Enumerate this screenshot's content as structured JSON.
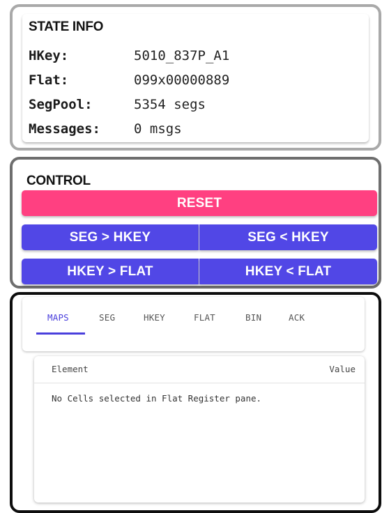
{
  "state_info": {
    "title": "STATE INFO",
    "rows": [
      {
        "key": "HKey:",
        "value": "5010_837P_A1"
      },
      {
        "key": "Flat:",
        "value": "099x00000889"
      },
      {
        "key": "SegPool:",
        "value": "5354 segs"
      },
      {
        "key": "Messages:",
        "value": "0 msgs"
      }
    ]
  },
  "control": {
    "title": "CONTROL",
    "reset_label": "RESET",
    "seg_to_hkey_label": "SEG > HKEY",
    "hkey_to_seg_label": "SEG < HKEY",
    "hkey_to_flat_label": "HKEY > FLAT",
    "flat_to_hkey_label": "HKEY < FLAT"
  },
  "tabs": {
    "items": [
      {
        "label": "MAPS",
        "active": true
      },
      {
        "label": "SEG",
        "active": false
      },
      {
        "label": "HKEY",
        "active": false
      },
      {
        "label": "FLAT",
        "active": false
      },
      {
        "label": "BIN",
        "active": false
      },
      {
        "label": "ACK",
        "active": false
      }
    ]
  },
  "table": {
    "col_element": "Element",
    "col_value": "Value",
    "empty_message": "No Cells selected in Flat Register pane."
  },
  "colors": {
    "reset": "#ff4081",
    "primary": "#5147e6",
    "tab_active": "#4a3fdc",
    "state_border": "#a9a9a9",
    "control_border": "#6e6e6e",
    "tabs_border": "#0d0d0d"
  }
}
